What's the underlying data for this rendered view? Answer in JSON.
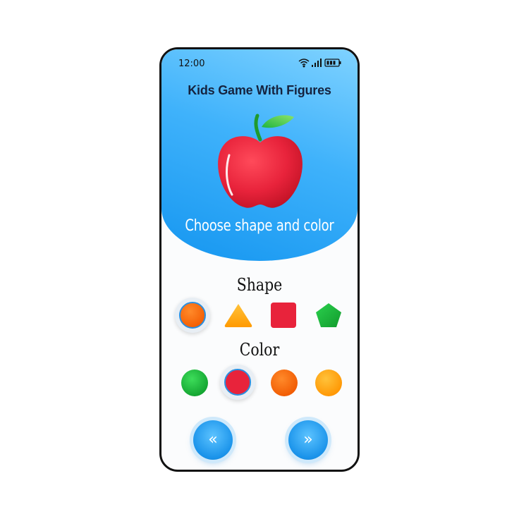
{
  "status_bar": {
    "time": "12:00"
  },
  "header": {
    "title": "Kids Game With Figures"
  },
  "hero": {
    "image": "red-apple",
    "subtitle": "Choose shape and color"
  },
  "shape_section": {
    "label": "Shape",
    "options": [
      {
        "name": "circle",
        "color": "#ff6a00",
        "selected": true
      },
      {
        "name": "triangle",
        "color": "#ffa500",
        "selected": false
      },
      {
        "name": "square",
        "color": "#e8233b",
        "selected": false
      },
      {
        "name": "pentagon",
        "color": "#17b33c",
        "selected": false
      }
    ]
  },
  "color_section": {
    "label": "Color",
    "options": [
      {
        "name": "green",
        "color": "#1cb83a",
        "selected": false
      },
      {
        "name": "red",
        "color": "#e8233b",
        "selected": true
      },
      {
        "name": "orange",
        "color": "#ff6a00",
        "selected": false
      },
      {
        "name": "yellow-orange",
        "color": "#ffa500",
        "selected": false
      }
    ]
  },
  "navigation": {
    "prev_icon": "«",
    "next_icon": "»"
  },
  "colors": {
    "hero_top": "#7fd2ff",
    "hero_bottom": "#1596f0",
    "button": "#1a93ea"
  }
}
